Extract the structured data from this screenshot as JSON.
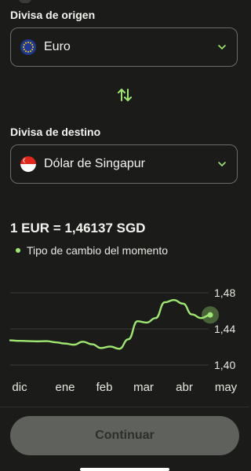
{
  "source": {
    "label": "Divisa de origen",
    "currency_name": "Euro",
    "flag": "eu-flag-icon"
  },
  "swap": {
    "icon": "swap-arrows-icon"
  },
  "target": {
    "label": "Divisa de destino",
    "currency_name": "Dólar de Singapur",
    "flag": "singapore-flag-icon"
  },
  "rate": {
    "text": "1 EUR = 1,46137 SGD",
    "live_label": "Tipo de cambio del momento"
  },
  "colors": {
    "accent": "#9fe870",
    "background": "#1b1c1a",
    "button_bg": "#5f615c"
  },
  "chart_data": {
    "type": "line",
    "categories": [
      "dic",
      "ene",
      "feb",
      "mar",
      "abr",
      "may"
    ],
    "y_ticks": [
      "1,48",
      "1,44",
      "1,40"
    ],
    "ylim": [
      1.4,
      1.48
    ],
    "series": [
      {
        "values": [
          1.4273,
          1.4268,
          1.4265,
          1.4262,
          1.4265,
          1.4252,
          1.4238,
          1.4225,
          1.4258,
          1.423,
          1.4188,
          1.4205,
          1.418,
          1.4285,
          1.4485,
          1.447,
          1.452,
          1.4695,
          1.472,
          1.468,
          1.456,
          1.452,
          1.4555
        ]
      }
    ]
  },
  "footer": {
    "continue_label": "Continuar"
  }
}
